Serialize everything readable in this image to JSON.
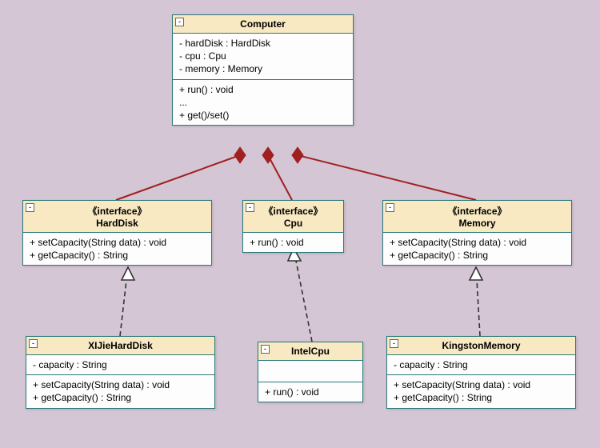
{
  "classes": {
    "computer": {
      "name": "Computer",
      "attrs": [
        "- hardDisk : HardDisk",
        "- cpu : Cpu",
        "- memory : Memory"
      ],
      "ops": [
        "+ run() : void",
        "...",
        "+ get()/set()"
      ]
    },
    "harddisk": {
      "stereo": "《interface》",
      "name": "HardDisk",
      "ops": [
        "+ setCapacity(String data) : void",
        "+ getCapacity() : String"
      ]
    },
    "cpu": {
      "stereo": "《interface》",
      "name": "Cpu",
      "ops": [
        "+ run() : void"
      ]
    },
    "memory": {
      "stereo": "《interface》",
      "name": "Memory",
      "ops": [
        "+ setCapacity(String data) : void",
        "+ getCapacity() : String"
      ]
    },
    "xijie": {
      "name": "XIJieHardDisk",
      "attrs": [
        "- capacity : String"
      ],
      "ops": [
        "+ setCapacity(String data) : void",
        "+ getCapacity() : String"
      ]
    },
    "intel": {
      "name": "IntelCpu",
      "attrs": [],
      "ops": [
        "+ run() : void"
      ]
    },
    "kingston": {
      "name": "KingstonMemory",
      "attrs": [
        "- capacity : String"
      ],
      "ops": [
        "+ setCapacity(String data) : void",
        "+ getCapacity() : String"
      ]
    }
  },
  "colors": {
    "composition": "#a02020",
    "realization": "#333"
  },
  "chart_data": {
    "type": "uml-class-diagram",
    "classes": [
      {
        "id": "Computer",
        "kind": "class",
        "attributes": [
          "- hardDisk : HardDisk",
          "- cpu : Cpu",
          "- memory : Memory"
        ],
        "operations": [
          "+ run() : void",
          "...",
          "+ get()/set()"
        ]
      },
      {
        "id": "HardDisk",
        "kind": "interface",
        "operations": [
          "+ setCapacity(String data) : void",
          "+ getCapacity() : String"
        ]
      },
      {
        "id": "Cpu",
        "kind": "interface",
        "operations": [
          "+ run() : void"
        ]
      },
      {
        "id": "Memory",
        "kind": "interface",
        "operations": [
          "+ setCapacity(String data) : void",
          "+ getCapacity() : String"
        ]
      },
      {
        "id": "XIJieHardDisk",
        "kind": "class",
        "attributes": [
          "- capacity : String"
        ],
        "operations": [
          "+ setCapacity(String data) : void",
          "+ getCapacity() : String"
        ]
      },
      {
        "id": "IntelCpu",
        "kind": "class",
        "attributes": [],
        "operations": [
          "+ run() : void"
        ]
      },
      {
        "id": "KingstonMemory",
        "kind": "class",
        "attributes": [
          "- capacity : String"
        ],
        "operations": [
          "+ setCapacity(String data) : void",
          "+ getCapacity() : String"
        ]
      }
    ],
    "relationships": [
      {
        "from": "Computer",
        "to": "HardDisk",
        "type": "composition"
      },
      {
        "from": "Computer",
        "to": "Cpu",
        "type": "composition"
      },
      {
        "from": "Computer",
        "to": "Memory",
        "type": "composition"
      },
      {
        "from": "XIJieHardDisk",
        "to": "HardDisk",
        "type": "realization"
      },
      {
        "from": "IntelCpu",
        "to": "Cpu",
        "type": "realization"
      },
      {
        "from": "KingstonMemory",
        "to": "Memory",
        "type": "realization"
      }
    ]
  }
}
